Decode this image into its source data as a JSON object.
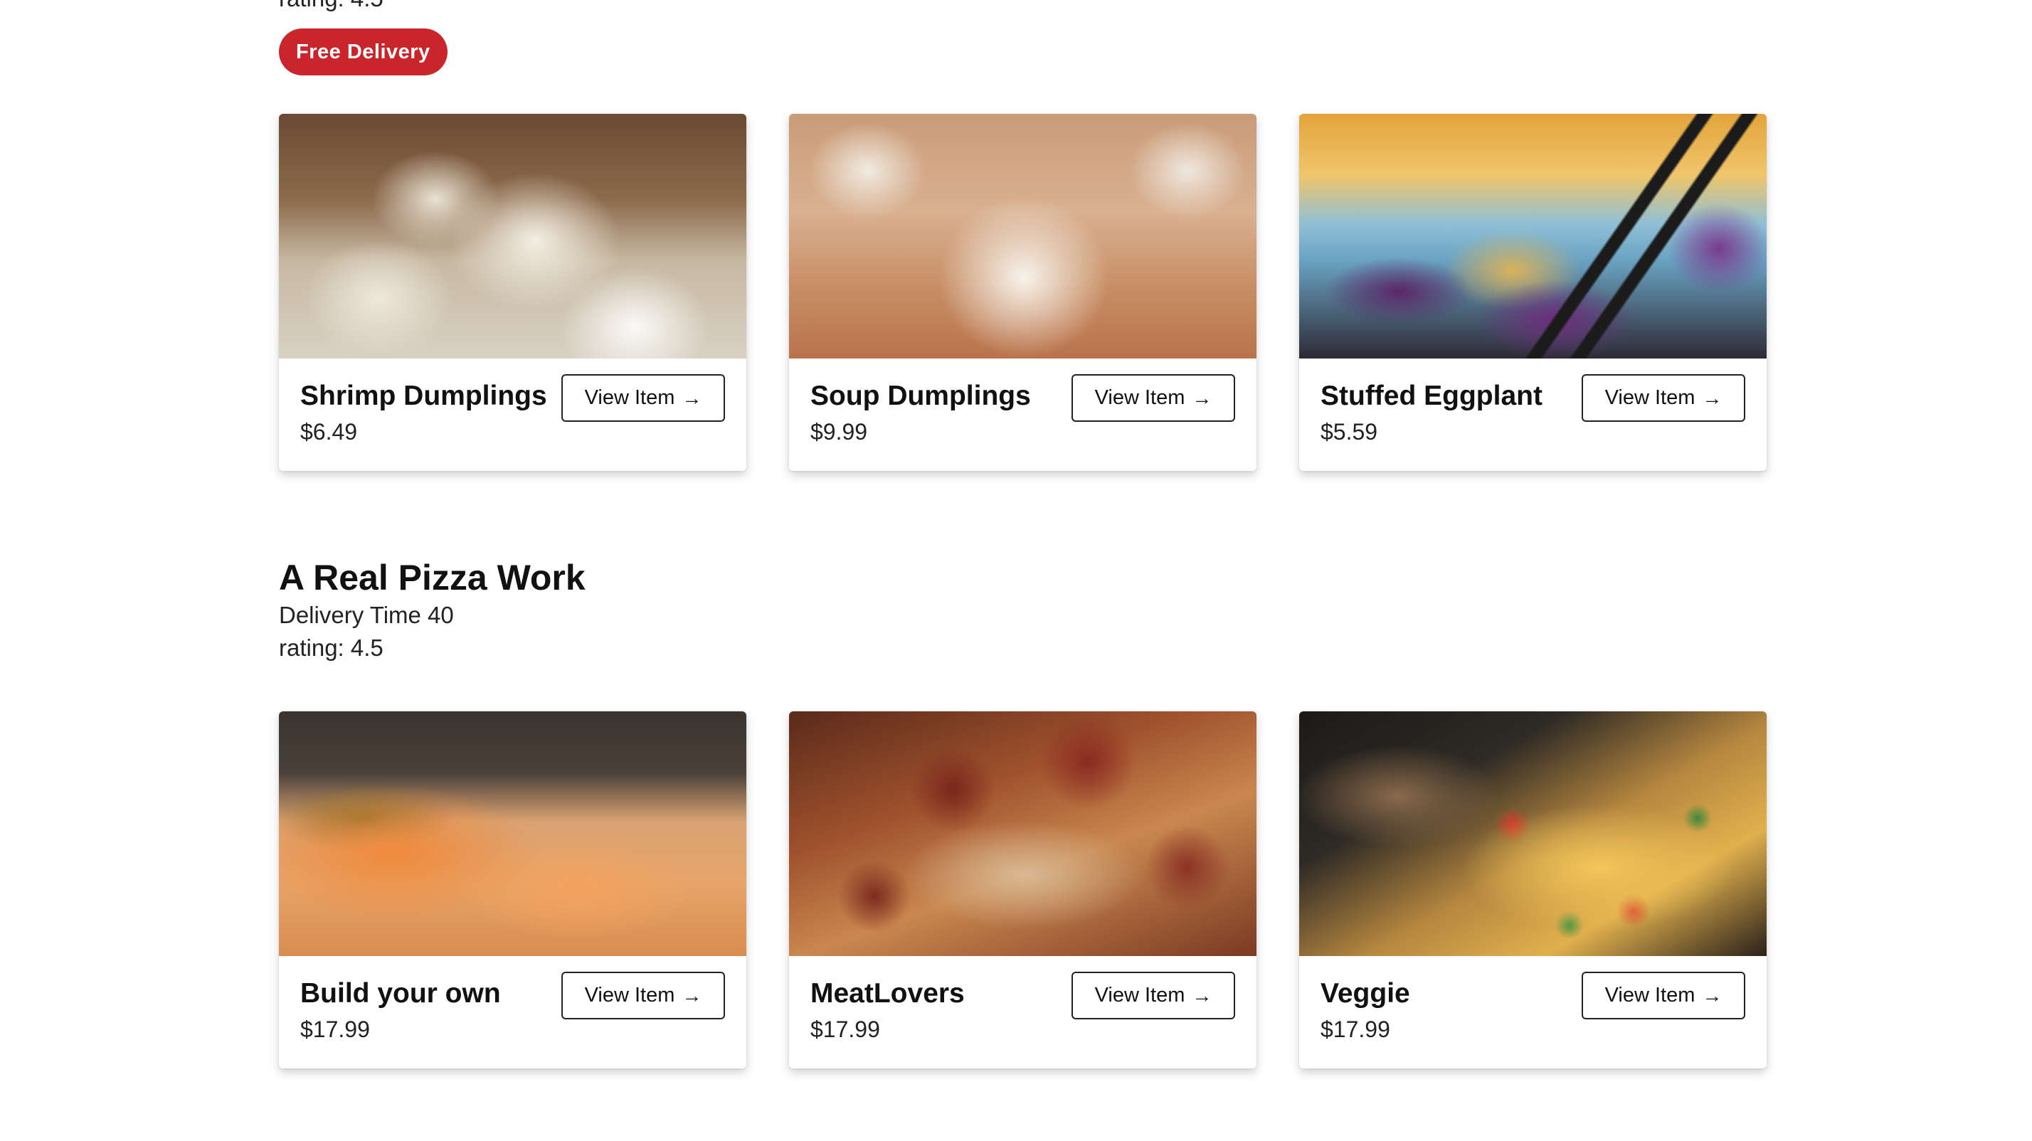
{
  "top_restaurant": {
    "rating_text": "rating: 4.5",
    "badge": "Free Delivery",
    "items": [
      {
        "name": "Shrimp Dumplings",
        "price": "$6.49",
        "button": "View Item",
        "button_icon": "arrow-right-icon"
      },
      {
        "name": "Soup Dumplings",
        "price": "$9.99",
        "button": "View Item",
        "button_icon": "arrow-right-icon"
      },
      {
        "name": "Stuffed Eggplant",
        "price": "$5.59",
        "button": "View Item",
        "button_icon": "arrow-right-icon"
      }
    ]
  },
  "pizza_restaurant": {
    "title": "A Real Pizza Work",
    "delivery": "Delivery Time 40",
    "rating_text": "rating: 4.5",
    "items": [
      {
        "name": "Build your own",
        "price": "$17.99",
        "button": "View Item",
        "button_icon": "arrow-right-icon"
      },
      {
        "name": "MeatLovers",
        "price": "$17.99",
        "button": "View Item",
        "button_icon": "arrow-right-icon"
      },
      {
        "name": "Veggie",
        "price": "$17.99",
        "button": "View Item",
        "button_icon": "arrow-right-icon"
      }
    ]
  },
  "colors": {
    "badge_bg": "#c9252b",
    "text": "#111111",
    "button_border": "#222222"
  }
}
